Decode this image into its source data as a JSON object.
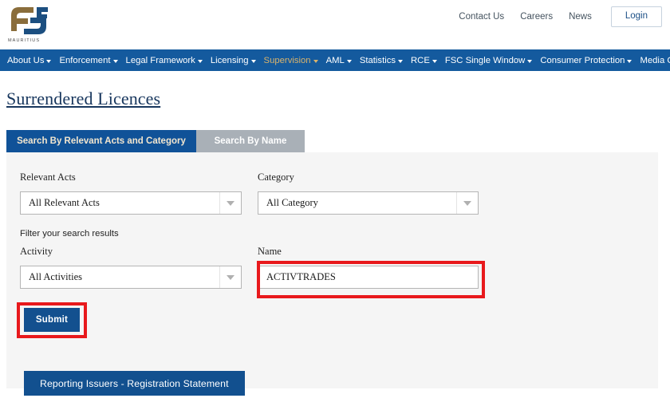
{
  "header": {
    "logo_alt": "fsc-mauritius-logo",
    "logo_wordmark": "MAURITIUS",
    "top_links": [
      {
        "label": "Contact Us",
        "name": "contact-us"
      },
      {
        "label": "Careers",
        "name": "careers"
      },
      {
        "label": "News",
        "name": "news"
      }
    ],
    "login_label": "Login"
  },
  "main_nav": {
    "items": [
      {
        "label": "About Us",
        "active": false
      },
      {
        "label": "Enforcement",
        "active": false
      },
      {
        "label": "Legal Framework",
        "active": false
      },
      {
        "label": "Licensing",
        "active": false
      },
      {
        "label": "Supervision",
        "active": true
      },
      {
        "label": "AML",
        "active": false
      },
      {
        "label": "Statistics",
        "active": false
      },
      {
        "label": "RCE",
        "active": false
      },
      {
        "label": "FSC Single Window",
        "active": false
      },
      {
        "label": "Consumer Protection",
        "active": false
      },
      {
        "label": "Media Corner",
        "active": false
      }
    ],
    "active_color": "#d9b36c",
    "bar_color": "#145a9e"
  },
  "page": {
    "title": "Surrendered Licences"
  },
  "tabs": [
    {
      "label": "Search By Relevant Acts and Category",
      "active": true
    },
    {
      "label": "Search By Name",
      "active": false
    }
  ],
  "form": {
    "relevant_acts": {
      "label": "Relevant Acts",
      "value": "All Relevant Acts"
    },
    "category": {
      "label": "Category",
      "value": "All Category"
    },
    "filter_helper": "Filter your search results",
    "activity": {
      "label": "Activity",
      "value": "All Activities"
    },
    "name": {
      "label": "Name",
      "value": "ACTIVTRADES",
      "placeholder": ""
    },
    "submit_label": "Submit",
    "reporting_issuers_label": "Reporting Issuers - Registration Statement"
  },
  "annotations": {
    "highlight_color": "#e8191c"
  }
}
